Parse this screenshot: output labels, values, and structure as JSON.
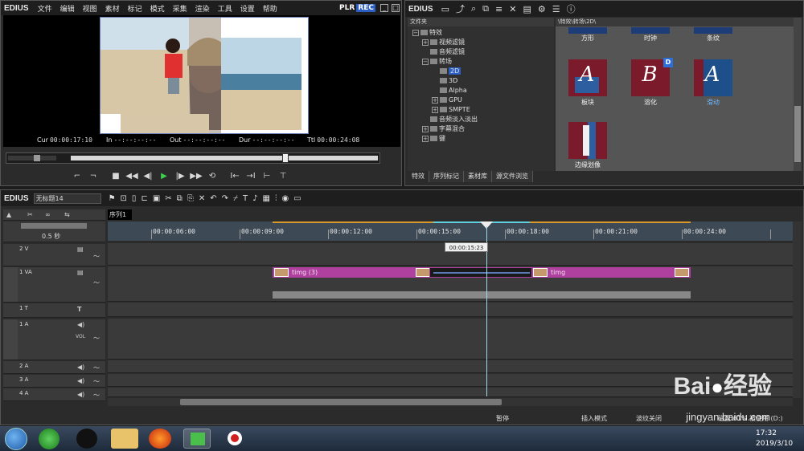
{
  "player": {
    "logo": "EDIUS",
    "menu": [
      "文件",
      "编辑",
      "视图",
      "素材",
      "标记",
      "模式",
      "采集",
      "渲染",
      "工具",
      "设置",
      "帮助"
    ],
    "plr_label": "PLR",
    "rec_label": "REC",
    "cur_label": "Cur",
    "cur_value": "00:00:17:10",
    "in_label": "In",
    "in_value": "--:--:--:--",
    "out_label": "Out",
    "out_value": "--:--:--:--",
    "dur_label": "Dur",
    "dur_value": "--:--:--:--",
    "ttl_label": "Ttl",
    "ttl_value": "00:00:24:08",
    "scrub_position": 0.7
  },
  "bin": {
    "logo": "EDIUS",
    "tree_header": "文件夹",
    "grid_header": "\\特效\\转场\\2D\\",
    "tree": [
      {
        "label": "特效",
        "indent": 0,
        "expanded": true
      },
      {
        "label": "视频滤镜",
        "indent": 1,
        "expanded": false
      },
      {
        "label": "音频滤镜",
        "indent": 1,
        "expanded": null
      },
      {
        "label": "转场",
        "indent": 1,
        "expanded": true
      },
      {
        "label": "2D",
        "indent": 2,
        "selected": true
      },
      {
        "label": "3D",
        "indent": 2
      },
      {
        "label": "Alpha",
        "indent": 2
      },
      {
        "label": "GPU",
        "indent": 2,
        "expanded": false
      },
      {
        "label": "SMPTE",
        "indent": 2,
        "expanded": false
      },
      {
        "label": "音频淡入淡出",
        "indent": 1,
        "expanded": null
      },
      {
        "label": "字幕混合",
        "indent": 1,
        "expanded": false
      },
      {
        "label": "键",
        "indent": 1,
        "expanded": false
      }
    ],
    "top_labels": [
      "方形",
      "时钟",
      "条纹"
    ],
    "thumbs": [
      {
        "letter": "A",
        "label": "板块"
      },
      {
        "letter": "B",
        "label": "溶化",
        "badge": "D"
      },
      {
        "letter": "A",
        "label": "滑动"
      },
      {
        "letter": "",
        "label": "边缘划像"
      }
    ],
    "tabs": [
      "特效",
      "序列标记",
      "素材库",
      "源文件浏览"
    ]
  },
  "timeline": {
    "logo": "EDIUS",
    "project": "无标题14",
    "sequence_tab": "序列1",
    "zoom_label": "0.5 秒",
    "ruler_ticks": [
      "00:00:06:00",
      "00:00:09:00",
      "00:00:12:00",
      "00:00:15:00",
      "00:00:18:00",
      "00:00:21:00",
      "00:00:24:00"
    ],
    "tooltip": "00:00:15:23",
    "tracks": [
      {
        "name": "2 V"
      },
      {
        "name": "1 VA"
      },
      {
        "name": "1 T"
      },
      {
        "name": "1 A"
      },
      {
        "name": "2 A"
      },
      {
        "name": "3 A"
      },
      {
        "name": "4 A"
      }
    ],
    "vol_label": "VOL",
    "clip1_label": "timg (3)",
    "clip2_label": "timg",
    "status": {
      "pause": "暂停",
      "insert": "插入模式",
      "ripple": "波纹关闭",
      "disk": "磁盘:61% 被使用 (D:)"
    }
  },
  "taskbar": {
    "time": "17:32",
    "date": "2019/3/10"
  },
  "watermark": {
    "brand": "Bai",
    "brand2": "经验",
    "url": "jingyan.baidu.com"
  },
  "colors": {
    "accent": "#2c5fc4",
    "clip": "#b040a0",
    "playhead": "#9fd8e8",
    "transition": "#7a1a2a"
  }
}
